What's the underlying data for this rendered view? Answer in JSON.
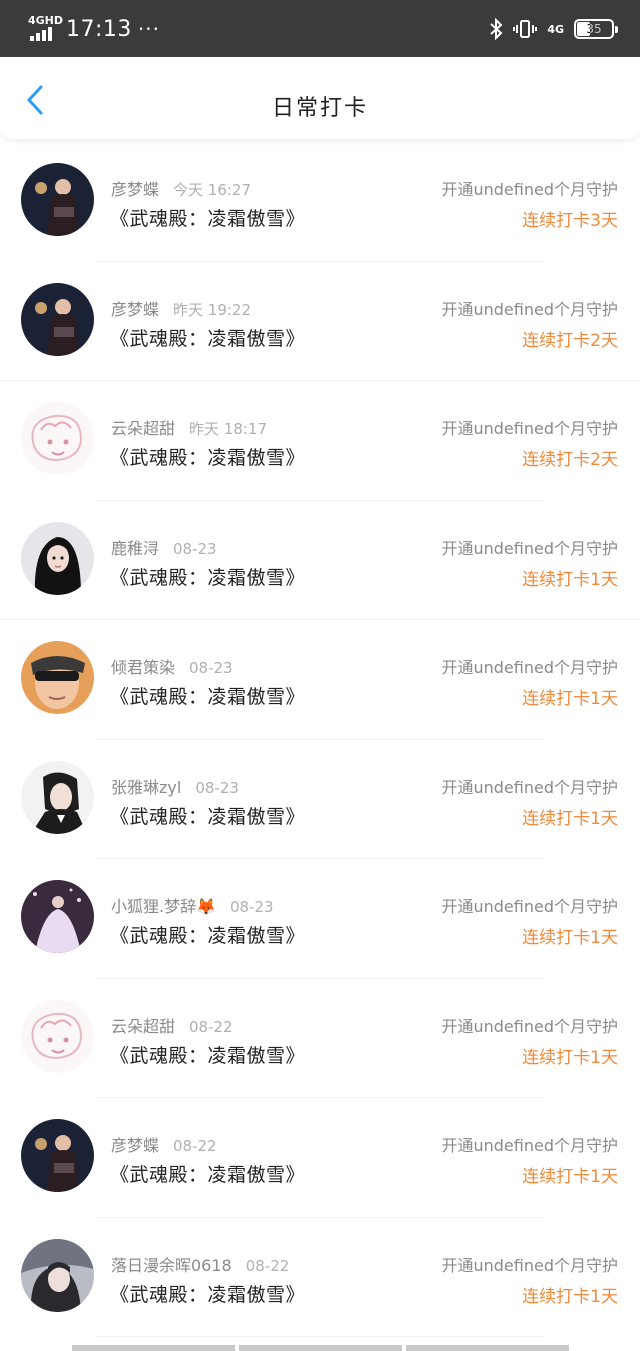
{
  "status_bar": {
    "network": "4GHD",
    "time": "17:13",
    "dots": "···",
    "signal_4g": "4G",
    "battery": "35"
  },
  "header": {
    "title": "日常打卡"
  },
  "rows": [
    {
      "name": "彦梦蝶",
      "time": "今天 16:27",
      "title": "《武魂殿：凌霜傲雪》",
      "guard": "开通undefined个月守护",
      "streak": "连续打卡3天",
      "avatar": "dark-night-photo"
    },
    {
      "name": "彦梦蝶",
      "time": "昨天 19:22",
      "title": "《武魂殿：凌霜傲雪》",
      "guard": "开通undefined个月守护",
      "streak": "连续打卡2天",
      "avatar": "dark-night-photo"
    },
    {
      "name": "云朵超甜",
      "time": "昨天 18:17",
      "title": "《武魂殿：凌霜傲雪》",
      "guard": "开通undefined个月守护",
      "streak": "连续打卡2天",
      "avatar": "pink-anime-sketch"
    },
    {
      "name": "鹿稚浔",
      "time": "08-23",
      "title": "《武魂殿：凌霜傲雪》",
      "guard": "开通undefined个月守护",
      "streak": "连续打卡1天",
      "avatar": "dark-hair-portrait"
    },
    {
      "name": "倾君策染",
      "time": "08-23",
      "title": "《武魂殿：凌霜傲雪》",
      "guard": "开通undefined个月守护",
      "streak": "连续打卡1天",
      "avatar": "sunglasses-portrait"
    },
    {
      "name": "张雅琳zyl",
      "time": "08-23",
      "title": "《武魂殿：凌霜傲雪》",
      "guard": "开通undefined个月守护",
      "streak": "连续打卡1天",
      "avatar": "suit-portrait"
    },
    {
      "name": "小狐狸.梦辞🦊",
      "time": "08-23",
      "title": "《武魂殿：凌霜傲雪》",
      "guard": "开通undefined个月守护",
      "streak": "连续打卡1天",
      "avatar": "white-dress-photo"
    },
    {
      "name": "云朵超甜",
      "time": "08-22",
      "title": "《武魂殿：凌霜傲雪》",
      "guard": "开通undefined个月守护",
      "streak": "连续打卡1天",
      "avatar": "pink-anime-sketch"
    },
    {
      "name": "彦梦蝶",
      "time": "08-22",
      "title": "《武魂殿：凌霜傲雪》",
      "guard": "开通undefined个月守护",
      "streak": "连续打卡1天",
      "avatar": "dark-night-photo"
    },
    {
      "name": "落日漫余晖0618",
      "time": "08-22",
      "title": "《武魂殿：凌霜傲雪》",
      "guard": "开通undefined个月守护",
      "streak": "连续打卡1天",
      "avatar": "grey-portrait"
    }
  ],
  "colors": {
    "accent": "#f0893a",
    "back_arrow": "#2a9df4",
    "status_bar": "#3b3b3b"
  }
}
